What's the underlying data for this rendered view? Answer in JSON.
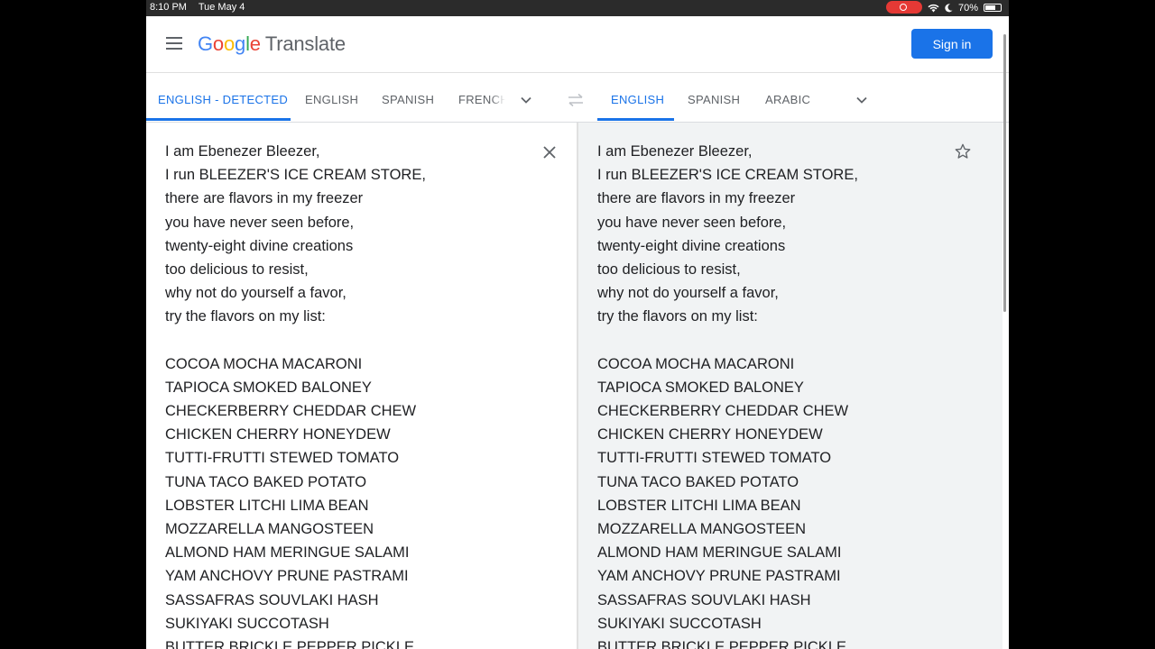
{
  "status_bar": {
    "time": "8:10 PM",
    "date": "Tue May 4",
    "battery": "70%",
    "battery_level": 0.7
  },
  "header": {
    "logo_letters": [
      "G",
      "o",
      "o",
      "g",
      "l",
      "e"
    ],
    "product": "Translate",
    "signin_label": "Sign in"
  },
  "source_languages": {
    "tabs": [
      "ENGLISH - DETECTED",
      "ENGLISH",
      "SPANISH",
      "FRENCH"
    ],
    "active_index": 0
  },
  "target_languages": {
    "tabs": [
      "ENGLISH",
      "SPANISH",
      "ARABIC"
    ],
    "active_index": 0
  },
  "source_text": [
    "I am Ebenezer Bleezer,",
    "I run BLEEZER'S ICE CREAM STORE,",
    "there are flavors in my freezer",
    "you have never seen before,",
    "twenty-eight divine creations",
    "too delicious to resist,",
    "why not do yourself a favor,",
    "try the flavors on my list:",
    "",
    "COCOA MOCHA MACARONI",
    "TAPIOCA SMOKED BALONEY",
    "CHECKERBERRY CHEDDAR CHEW",
    "CHICKEN CHERRY HONEYDEW",
    "TUTTI-FRUTTI STEWED TOMATO",
    "TUNA TACO BAKED POTATO",
    "LOBSTER LITCHI LIMA BEAN",
    "MOZZARELLA MANGOSTEEN",
    "ALMOND HAM MERINGUE SALAMI",
    "YAM ANCHOVY PRUNE PASTRAMI",
    "SASSAFRAS SOUVLAKI HASH",
    "SUKIYAKI SUCCOTASH",
    "BUTTER BRICKLE PEPPER PICKLE"
  ],
  "translated_text": [
    "I am Ebenezer Bleezer,",
    "I run BLEEZER'S ICE CREAM STORE,",
    "there are flavors in my freezer",
    "you have never seen before,",
    "twenty-eight divine creations",
    "too delicious to resist,",
    "why not do yourself a favor,",
    "try the flavors on my list:",
    "",
    "COCOA MOCHA MACARONI",
    "TAPIOCA SMOKED BALONEY",
    "CHECKERBERRY CHEDDAR CHEW",
    "CHICKEN CHERRY HONEYDEW",
    "TUTTI-FRUTTI STEWED TOMATO",
    "TUNA TACO BAKED POTATO",
    "LOBSTER LITCHI LIMA BEAN",
    "MOZZARELLA MANGOSTEEN",
    "ALMOND HAM MERINGUE SALAMI",
    "YAM ANCHOVY PRUNE PASTRAMI",
    "SASSAFRAS SOUVLAKI HASH",
    "SUKIYAKI SUCCOTASH",
    "BUTTER BRICKLE PEPPER PICKLE"
  ],
  "colors": {
    "accent": "#1a73e8",
    "target_bg": "#f1f3f4",
    "text": "#202124",
    "muted": "#5f6368"
  }
}
